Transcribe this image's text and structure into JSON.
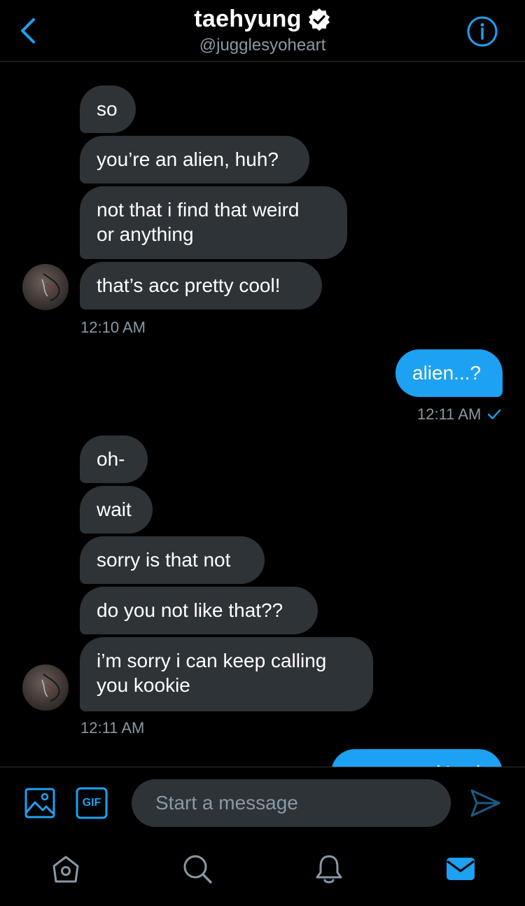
{
  "header": {
    "title": "taehyung",
    "handle": "@jugglesyoheart",
    "verified_icon": "verified-badge-icon",
    "back_icon": "chevron-left-icon",
    "info_icon": "info-icon"
  },
  "colors": {
    "accent": "#1da1f2",
    "incoming_bubble": "#2e3338",
    "muted_text": "#8899a6",
    "background": "#000000"
  },
  "messages": {
    "group1": {
      "m1": "so",
      "m2": "you’re an alien, huh?",
      "m3": "not that i find that weird\nor anything",
      "m4": "that’s acc pretty cool!",
      "time": "12:10 AM"
    },
    "outgoing1": {
      "text": "alien...?",
      "time": "12:11 AM",
      "read_icon": "checkmark-icon"
    },
    "group2": {
      "m1": "oh-",
      "m2": "wait",
      "m3": "sorry is that not",
      "m4": "do you not like that??",
      "m5": "i’m sorry i can keep calling\nyou kookie",
      "time": "12:11 AM"
    },
    "outgoing2_partial": {
      "text": "it's ok"
    }
  },
  "compose": {
    "placeholder": "Start a message",
    "gif_label": "GIF",
    "image_icon": "image-icon",
    "send_icon": "send-icon"
  },
  "tabbar": {
    "items": [
      "home-icon",
      "search-icon",
      "notifications-icon",
      "messages-icon"
    ],
    "active": "messages-icon"
  }
}
